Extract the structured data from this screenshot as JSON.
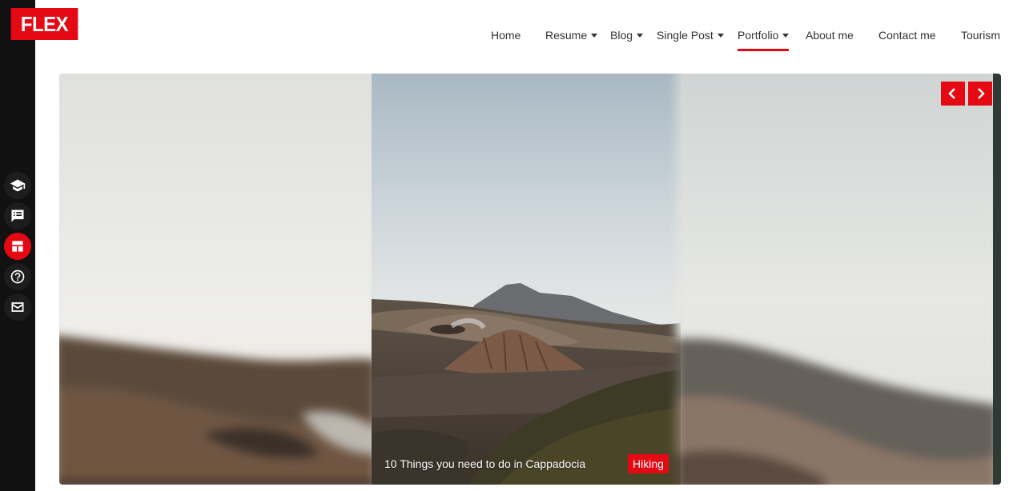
{
  "brand": {
    "logo_text": "FLEX",
    "accent": "#e50914"
  },
  "nav": {
    "items": [
      {
        "label": "Home",
        "has_caret": false,
        "active": false
      },
      {
        "label": "Resume",
        "has_caret": true,
        "active": false
      },
      {
        "label": "Blog",
        "has_caret": true,
        "active": false
      },
      {
        "label": "Single Post",
        "has_caret": true,
        "active": false
      },
      {
        "label": "Portfolio",
        "has_caret": true,
        "active": true
      },
      {
        "label": "About me",
        "has_caret": false,
        "active": false
      },
      {
        "label": "Contact me",
        "has_caret": false,
        "active": false
      },
      {
        "label": "Tourism",
        "has_caret": false,
        "active": false
      }
    ]
  },
  "sidebar": {
    "icons": [
      {
        "name": "graduation-cap-icon",
        "active": false
      },
      {
        "name": "comment-list-icon",
        "active": false
      },
      {
        "name": "dashboard-icon",
        "active": true
      },
      {
        "name": "help-circle-icon",
        "active": false
      },
      {
        "name": "mail-icon",
        "active": false
      }
    ]
  },
  "slider": {
    "active_slide": {
      "title": "10 Things you need to do in Cappadocia",
      "category": "Hiking"
    },
    "controls": {
      "prev_icon": "chevron-left-icon",
      "next_icon": "chevron-right-icon"
    }
  }
}
